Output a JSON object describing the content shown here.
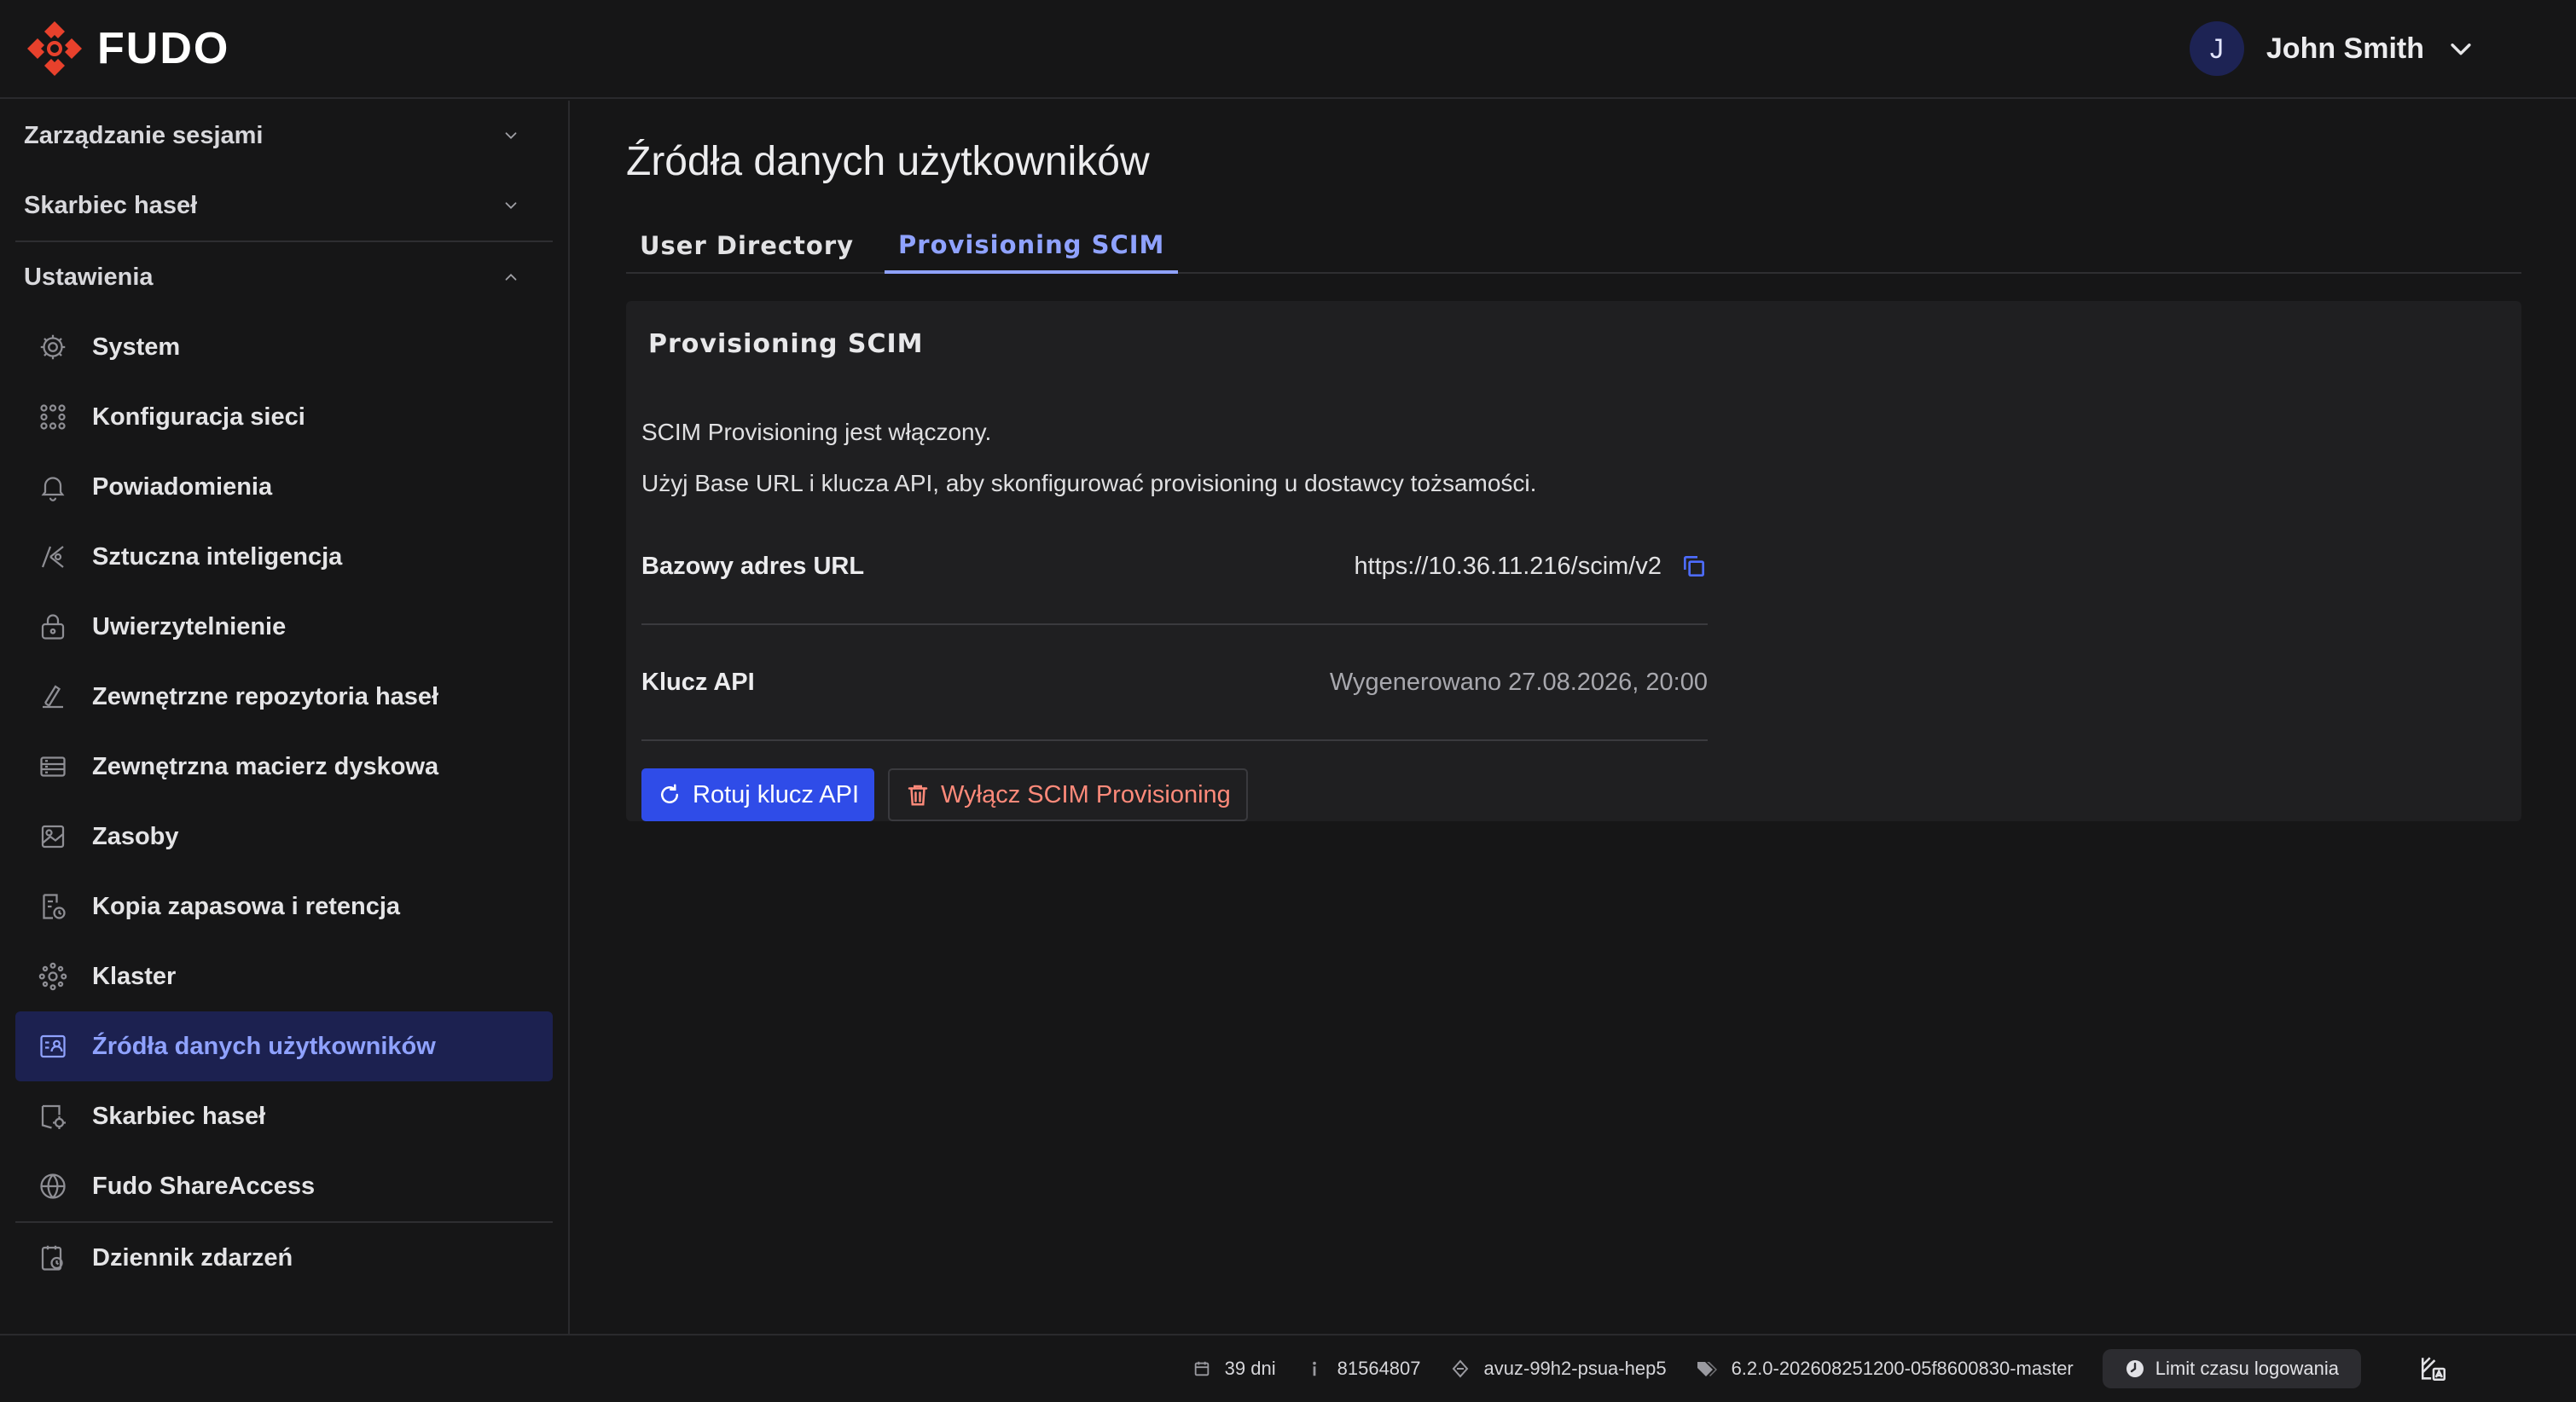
{
  "app": {
    "logo_text": "FUDO",
    "user_initial": "J",
    "user_name": "John Smith"
  },
  "sidebar": {
    "sections": [
      {
        "label": "Zarządzanie sesjami",
        "expanded": false
      },
      {
        "label": "Skarbiec haseł",
        "expanded": false
      },
      {
        "label": "Ustawienia",
        "expanded": true
      }
    ],
    "items": [
      {
        "label": "System",
        "icon": "gear-icon"
      },
      {
        "label": "Konfiguracja sieci",
        "icon": "network-icon"
      },
      {
        "label": "Powiadomienia",
        "icon": "bell-icon"
      },
      {
        "label": "Sztuczna inteligencja",
        "icon": "ai-icon"
      },
      {
        "label": "Uwierzytelnienie",
        "icon": "lock-icon"
      },
      {
        "label": "Zewnętrzne repozytoria haseł",
        "icon": "repository-icon"
      },
      {
        "label": "Zewnętrzna macierz dyskowa",
        "icon": "disk-array-icon"
      },
      {
        "label": "Zasoby",
        "icon": "resources-icon"
      },
      {
        "label": "Kopia zapasowa i retencja",
        "icon": "backup-icon"
      },
      {
        "label": "Klaster",
        "icon": "cluster-icon"
      },
      {
        "label": "Źródła danych użytkowników",
        "icon": "user-directory-icon",
        "active": true
      },
      {
        "label": "Skarbiec haseł",
        "icon": "vault-icon"
      },
      {
        "label": "Fudo ShareAccess",
        "icon": "share-access-icon"
      }
    ],
    "bottom_item": {
      "label": "Dziennik zdarzeń",
      "icon": "event-log-icon"
    }
  },
  "main": {
    "title": "Źródła danych użytkowników",
    "tabs": [
      {
        "label": "User Directory",
        "active": false
      },
      {
        "label": "Provisioning SCIM",
        "active": true
      }
    ],
    "panel": {
      "title": "Provisioning SCIM",
      "status_text": "SCIM Provisioning jest włączony.",
      "help_text": "Użyj Base URL i klucza API, aby skonfigurować provisioning u dostawcy tożsamości.",
      "base_url_label": "Bazowy adres URL",
      "base_url_value": "https://10.36.11.216/scim/v2",
      "api_key_label": "Klucz API",
      "api_key_value": "Wygenerowano 27.08.2026, 20:00",
      "rotate_button": "Rotuj klucz API",
      "disable_button": "Wyłącz SCIM Provisioning"
    }
  },
  "footer": {
    "days": "39 dni",
    "id": "81564807",
    "host": "avuz-99h2-psua-hep5",
    "version": "6.2.0-202608251200-05f8600830-master",
    "login_limit": "Limit czasu logowania"
  },
  "colors": {
    "accent": "#8fa2ff",
    "primary_button": "#2f4ce8",
    "danger": "#ff8a7a",
    "logo": "#e8412c"
  }
}
